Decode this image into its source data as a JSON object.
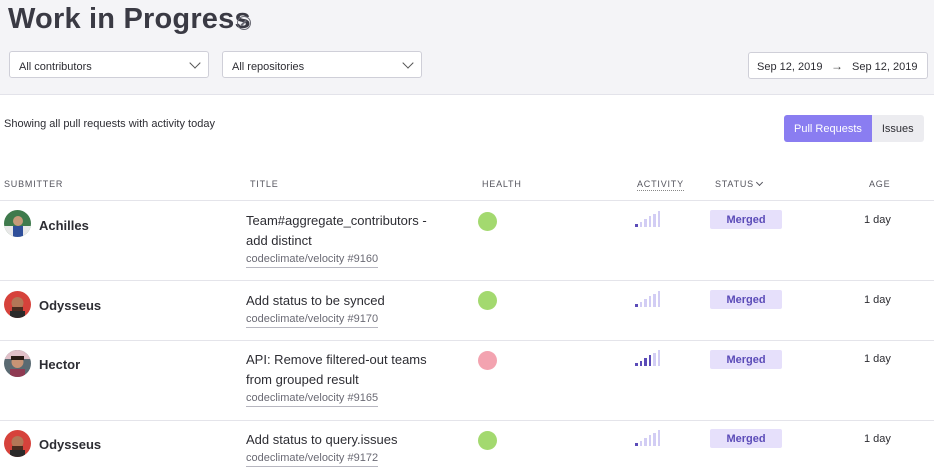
{
  "page": {
    "title": "Work in Progress",
    "title_icon": "compass-icon"
  },
  "filters": {
    "contributors": "All contributors",
    "repositories": "All repositories",
    "date_from": "Sep 12, 2019",
    "date_arrow": "→",
    "date_to": "Sep 12, 2019"
  },
  "summary": "Showing all pull requests with activity today",
  "toggle": {
    "pull_requests": "Pull Requests",
    "issues": "Issues",
    "selected": "Pull Requests"
  },
  "columns": {
    "submitter": "SUBMITTER",
    "title": "TITLE",
    "health": "HEALTH",
    "activity": "ACTIVITY",
    "status": "STATUS",
    "age": "AGE"
  },
  "colors": {
    "accent": "#8a7df1",
    "health_good": "#a3d96f",
    "health_bad": "#f3a3b0",
    "activity_dark": "#5b4bb8",
    "activity_light": "#d2cdf4",
    "badge_bg": "#e6e0fb",
    "badge_text": "#5b4bb8"
  },
  "rows": [
    {
      "submitter": "Achilles",
      "title": "Team#aggregate_contributors - add distinct",
      "repo": "codeclimate/velocity #9160",
      "health": "good",
      "activity_level": 1,
      "status": "Merged",
      "age": "1 day"
    },
    {
      "submitter": "Odysseus",
      "title": "Add status to be synced",
      "repo": "codeclimate/velocity #9170",
      "health": "good",
      "activity_level": 1,
      "status": "Merged",
      "age": "1 day"
    },
    {
      "submitter": "Hector",
      "title": "API: Remove filtered-out teams from grouped result",
      "repo": "codeclimate/velocity #9165",
      "health": "bad",
      "activity_level": 4,
      "status": "Merged",
      "age": "1 day"
    },
    {
      "submitter": "Odysseus",
      "title": "Add status to query.issues",
      "repo": "codeclimate/velocity #9172",
      "health": "good",
      "activity_level": 1,
      "status": "Merged",
      "age": "1 day"
    }
  ]
}
